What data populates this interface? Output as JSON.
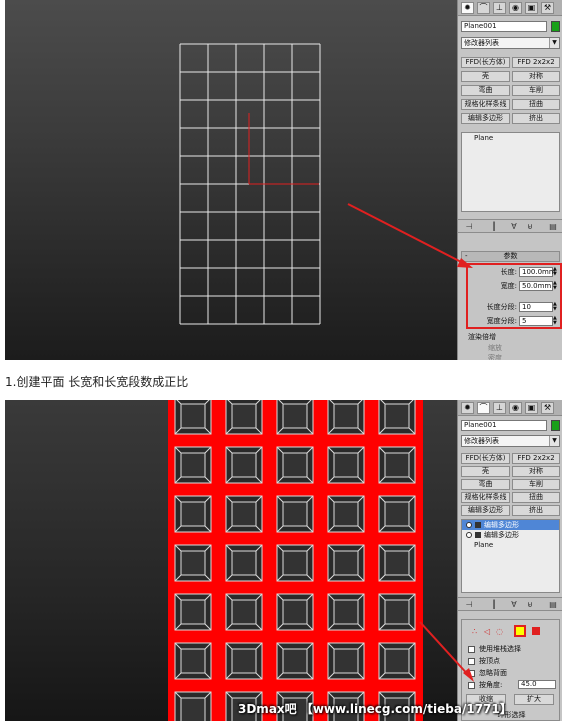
{
  "step1": {
    "panel": {
      "tab_icons": [
        "sun-icon",
        "curve-icon",
        "hierarchy-icon",
        "motion-icon",
        "display-icon",
        "utilities-icon"
      ],
      "object_name": "Plane001",
      "object_color": "#18a018",
      "modifier_list_label": "修改器列表",
      "modifier_buttons": [
        "FFD(长方体)",
        "FFD 2x2x2",
        "壳",
        "对称",
        "弯曲",
        "车削",
        "规格化样条线",
        "扭曲",
        "编辑多边形",
        "挤出"
      ],
      "stack_items": [
        "Plane"
      ],
      "params_title": "参数",
      "params": [
        {
          "label": "长度:",
          "value": "100.0mm"
        },
        {
          "label": "宽度:",
          "value": "50.0mm"
        },
        {
          "label": "长度分段:",
          "value": "10"
        },
        {
          "label": "宽度分段:",
          "value": "5"
        }
      ],
      "render_multiplier_label": "渲染倍增",
      "row_partial_1": "缩放",
      "row_partial_2": "密度"
    },
    "grid": {
      "length_segments": 10,
      "width_segments": 5
    },
    "highlight_color": "#e02020"
  },
  "caption": "1.创建平面 长宽和长宽段数成正比",
  "step2": {
    "panel": {
      "tab_icons": [
        "sun-icon",
        "curve-icon",
        "hierarchy-icon",
        "motion-icon",
        "display-icon",
        "utilities-icon"
      ],
      "object_name": "Plane001",
      "object_color": "#18a018",
      "modifier_list_label": "修改器列表",
      "modifier_buttons": [
        "FFD(长方体)",
        "FFD 2x2x2",
        "壳",
        "对称",
        "弯曲",
        "车削",
        "规格化样条线",
        "扭曲",
        "编辑多边形",
        "挤出"
      ],
      "stack_items": [
        {
          "label": "编辑多边形",
          "selected": true
        },
        {
          "label": "编辑多边形",
          "selected": false
        },
        {
          "label": "Plane",
          "selected": false
        }
      ],
      "selection_options": [
        {
          "label": "使用堆栈选择"
        },
        {
          "label": "按顶点"
        },
        {
          "label": "忽略背面"
        },
        {
          "label": "按角度:",
          "value": "45.0"
        }
      ],
      "buttons": [
        "收缩",
        "扩大"
      ],
      "ring_label": "环形选择"
    },
    "mesh": {
      "columns": 5,
      "rows": 7,
      "face_color": "#ff0000"
    }
  },
  "watermark": "3Dmax吧 【www.linecg.com/tieba/1771】"
}
